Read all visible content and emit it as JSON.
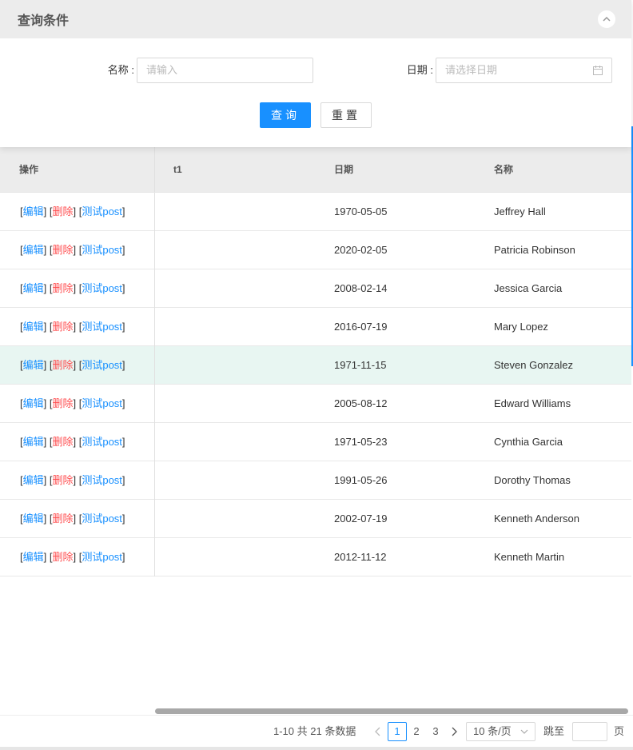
{
  "query": {
    "title": "查询条件",
    "name_label": "名称 :",
    "name_placeholder": "请输入",
    "date_label": "日期 :",
    "date_placeholder": "请选择日期",
    "query_button": "查询",
    "reset_button": "重置"
  },
  "table": {
    "headers": {
      "op": "操作",
      "t1": "t1",
      "date": "日期",
      "name": "名称"
    },
    "actions": {
      "edit": "编辑",
      "delete": "删除",
      "test": "测试post"
    },
    "rows": [
      {
        "t1": "",
        "date": "1970-05-05",
        "name": "Jeffrey Hall"
      },
      {
        "t1": "",
        "date": "2020-02-05",
        "name": "Patricia Robinson"
      },
      {
        "t1": "",
        "date": "2008-02-14",
        "name": "Jessica Garcia"
      },
      {
        "t1": "",
        "date": "2016-07-19",
        "name": "Mary Lopez"
      },
      {
        "t1": "",
        "date": "1971-11-15",
        "name": "Steven Gonzalez"
      },
      {
        "t1": "",
        "date": "2005-08-12",
        "name": "Edward Williams"
      },
      {
        "t1": "",
        "date": "1971-05-23",
        "name": "Cynthia Garcia"
      },
      {
        "t1": "",
        "date": "1991-05-26",
        "name": "Dorothy Thomas"
      },
      {
        "t1": "",
        "date": "2002-07-19",
        "name": "Kenneth Anderson"
      },
      {
        "t1": "",
        "date": "2012-11-12",
        "name": "Kenneth Martin"
      }
    ],
    "highlighted_row": 4
  },
  "pagination": {
    "info": "1-10 共 21 条数据",
    "pages": [
      "1",
      "2",
      "3"
    ],
    "current": "1",
    "page_size": "10 条/页",
    "jump_label": "跳至",
    "page_unit": "页"
  },
  "colors": {
    "primary": "#1890ff",
    "danger": "#ff4d4f",
    "highlight_row": "#e8f6f2"
  }
}
